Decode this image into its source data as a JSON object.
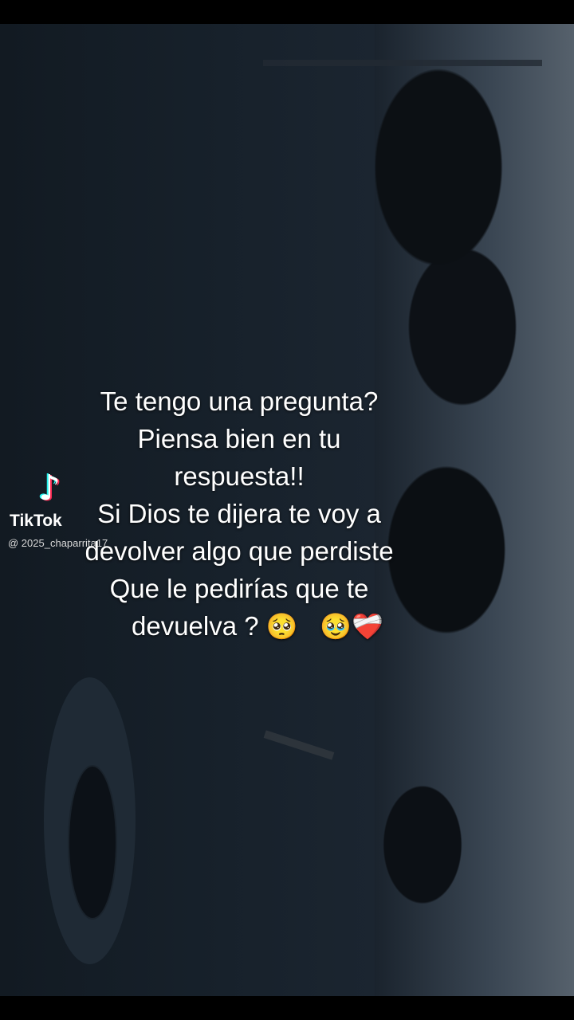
{
  "watermark": {
    "brand": "TikTok",
    "handle": "@ 2025_chaparrita17"
  },
  "caption": {
    "lines": [
      "Te tengo una pregunta?",
      "Piensa bien en tu",
      "respuesta!!",
      "Si Dios te dijera te voy a",
      "devolver algo que perdiste",
      "Que le pedirías que te"
    ],
    "last_line_text": "devuelva ?",
    "emojis": [
      "🥺",
      "🥹",
      "❤️‍🩹"
    ]
  }
}
